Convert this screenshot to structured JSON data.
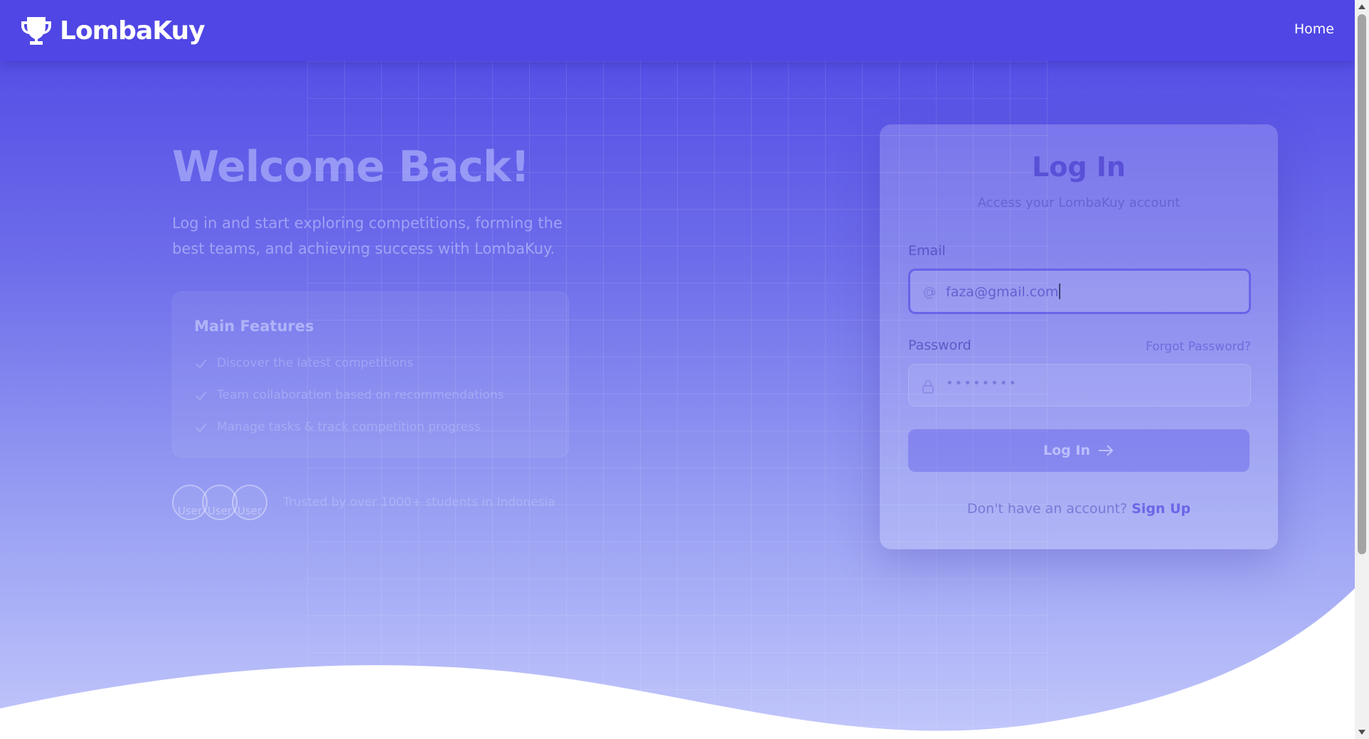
{
  "nav": {
    "brand": "LombaKuy",
    "home": "Home"
  },
  "hero": {
    "title": "Welcome Back!",
    "subtitle": "Log in and start exploring competitions, forming the best teams, and achieving success with LombaKuy.",
    "features_title": "Main Features",
    "features": [
      "Discover the latest competitions",
      "Team collaboration based on recommendations",
      "Manage tasks & track competition progress"
    ],
    "avatars": [
      "User",
      "User",
      "User"
    ],
    "trust": "Trusted by over 1000+ students in Indonesia"
  },
  "login": {
    "title": "Log In",
    "subtitle": "Access your LombaKuy account",
    "email_label": "Email",
    "email_value": "faza@gmail.com",
    "password_label": "Password",
    "forgot": "Forgot Password?",
    "password_mask": "••••••••",
    "submit": "Log In",
    "signup_prompt": "Don't have an account?",
    "signup_link": "Sign Up"
  }
}
